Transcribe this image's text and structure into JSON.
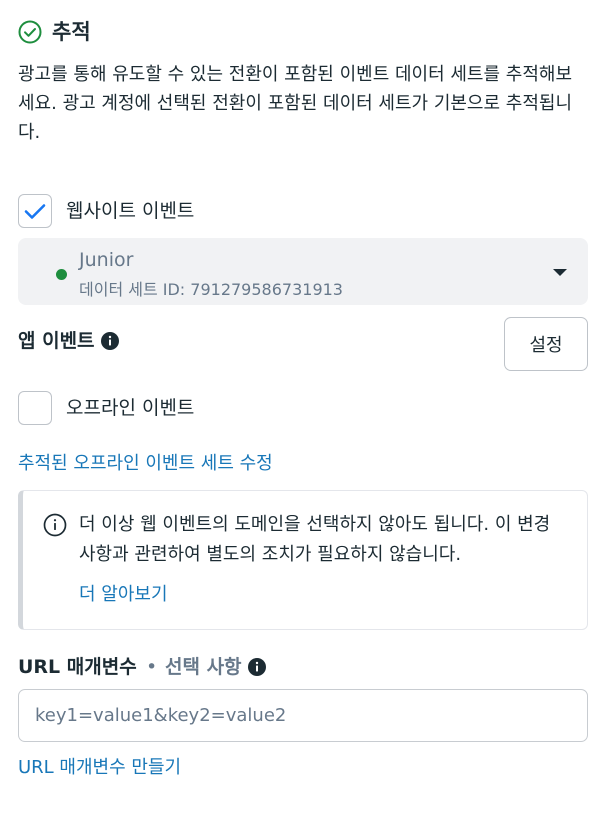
{
  "header": {
    "title": "추적",
    "description": "광고를 통해 유도할 수 있는 전환이 포함된 이벤트 데이터 세트를 추적해보세요. 광고 계정에 선택된 전환이 포함된 데이터 세트가 기본으로 추적됩니다."
  },
  "website_events": {
    "label": "웹사이트 이벤트",
    "checked": true,
    "dataset": {
      "name": "Junior",
      "id_text": "데이터 세트 ID: 791279586731913",
      "status_color": "#1e8e3e"
    }
  },
  "app_events": {
    "label": "앱 이벤트",
    "settings_button": "설정"
  },
  "offline_events": {
    "label": "오프라인 이벤트",
    "checked": false,
    "edit_link": "추적된 오프라인 이벤트 세트 수정"
  },
  "notice": {
    "text": "더 이상 웹 이벤트의 도메인을 선택하지 않아도 됩니다. 이 변경 사항과 관련하여 별도의 조치가 필요하지 않습니다.",
    "learn_more": "더 알아보기"
  },
  "url_params": {
    "label": "URL 매개변수",
    "separator": "•",
    "optional": "선택 사항",
    "placeholder": "key1=value1&key2=value2",
    "create_link": "URL 매개변수 만들기"
  },
  "colors": {
    "accent_link": "#1877b8",
    "checkbox_check": "#1877f2",
    "success_icon": "#1e8e3e"
  }
}
